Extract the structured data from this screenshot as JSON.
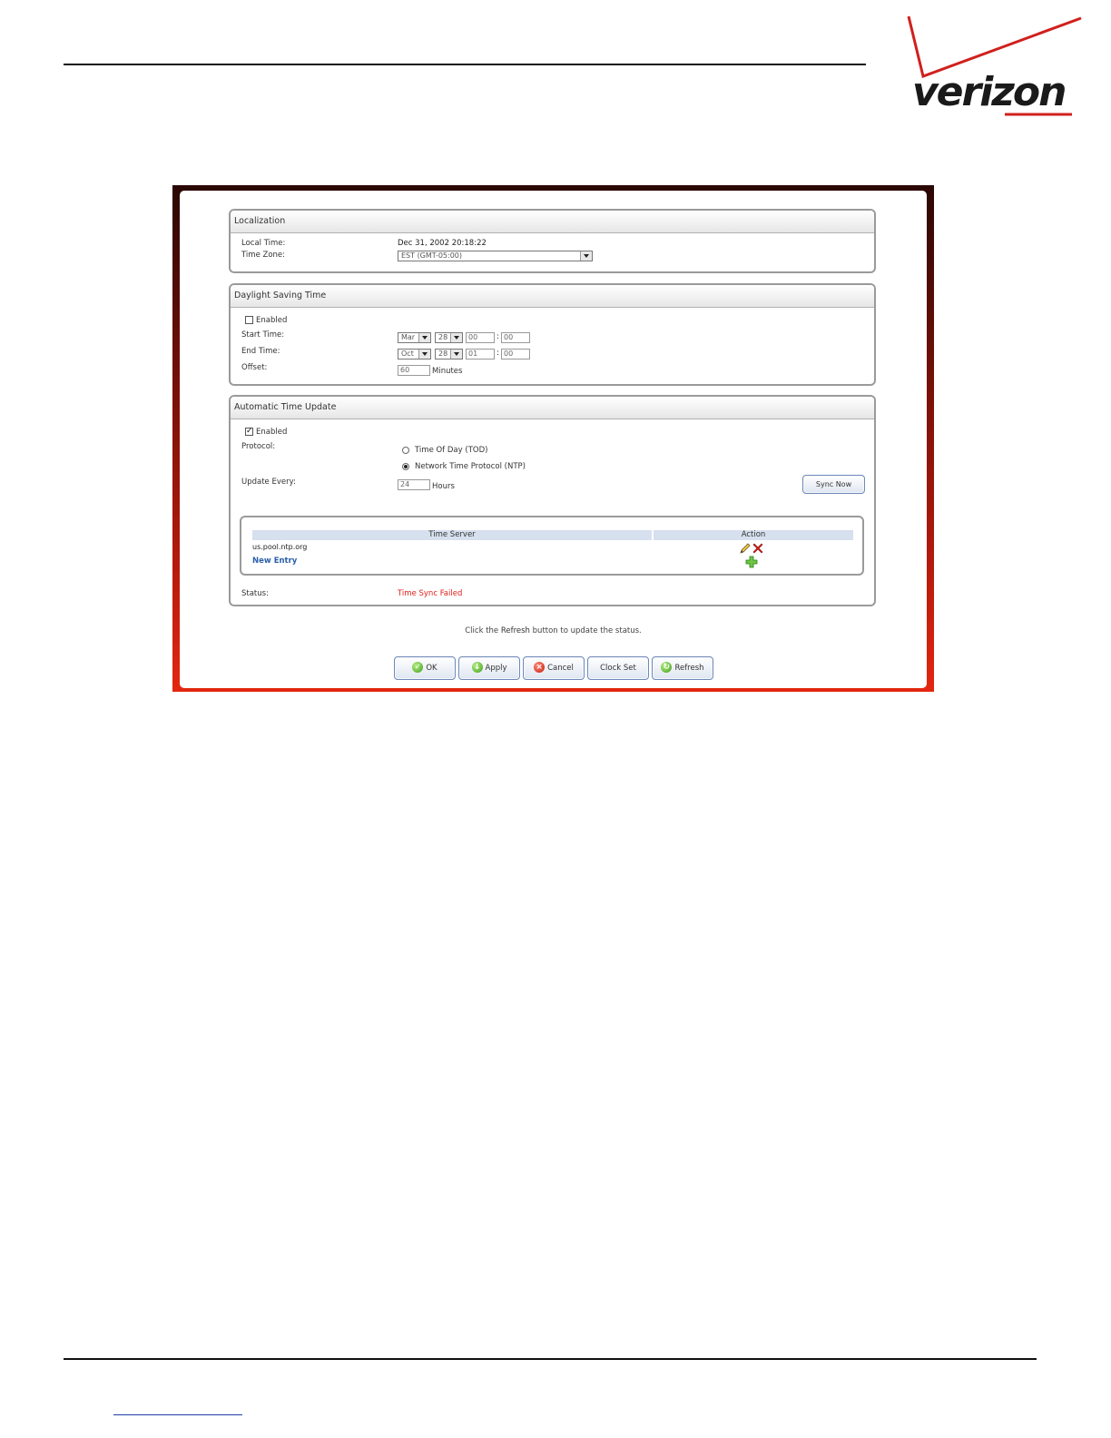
{
  "brand": {
    "logo_text": "verizon",
    "accent": "#cc1f1f"
  },
  "localization": {
    "header": "Localization",
    "local_time_label": "Local Time:",
    "local_time_value": "Dec 31, 2002 20:18:22",
    "time_zone_label": "Time Zone:",
    "time_zone_value": "EST (GMT-05:00)"
  },
  "dst": {
    "header": "Daylight Saving Time",
    "enabled_label": "Enabled",
    "enabled": false,
    "start_label": "Start Time:",
    "start_month": "Mar",
    "start_day": "28",
    "start_hour": "00",
    "start_min": "00",
    "end_label": "End Time:",
    "end_month": "Oct",
    "end_day": "28",
    "end_hour": "01",
    "end_min": "00",
    "offset_label": "Offset:",
    "offset_value": "60",
    "offset_unit": "Minutes",
    "separator": ":"
  },
  "atu": {
    "header": "Automatic Time Update",
    "enabled_label": "Enabled",
    "enabled": true,
    "protocol_label": "Protocol:",
    "protocol_tod": "Time Of Day (TOD)",
    "protocol_ntp": "Network Time Protocol (NTP)",
    "update_label": "Update Every:",
    "update_value": "24",
    "update_unit": "Hours",
    "sync_button": "Sync Now",
    "table": {
      "col_server": "Time Server",
      "col_action": "Action",
      "rows": [
        "us.pool.ntp.org"
      ],
      "new_entry": "New Entry"
    },
    "status_label": "Status:",
    "status_value": "Time Sync Failed"
  },
  "hint": {
    "prefix": "Click the ",
    "keyword": "Refresh",
    "suffix": " button to update the status."
  },
  "buttons": {
    "ok": "OK",
    "apply": "Apply",
    "cancel": "Cancel",
    "clock_set": "Clock Set",
    "refresh": "Refresh"
  }
}
